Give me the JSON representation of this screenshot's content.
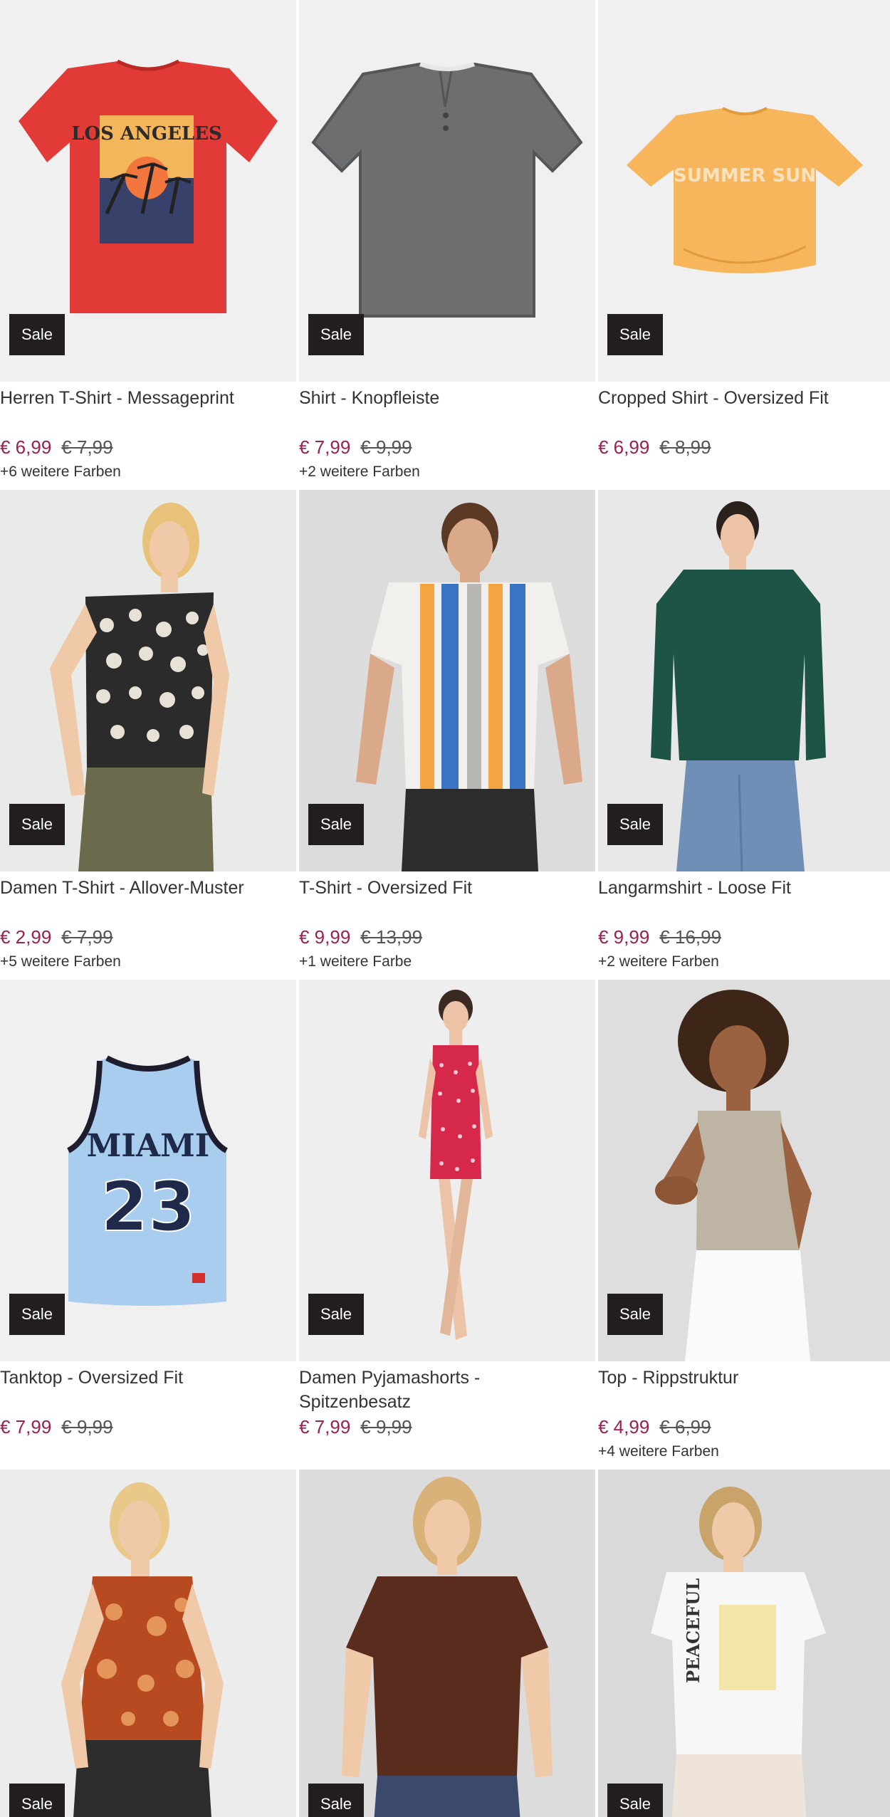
{
  "products": [
    {
      "name": "Herren T-Shirt - Messageprint",
      "badge": "Sale",
      "price": "€ 6,99",
      "old_price": "€ 7,99",
      "colors": "+6 weitere Farben",
      "bg": "#f1f0f0",
      "garment": "#e23a36"
    },
    {
      "name": "Shirt - Knopfleiste",
      "badge": "Sale",
      "price": "€ 7,99",
      "old_price": "€ 9,99",
      "colors": "+2 weitere Farben",
      "bg": "#f1f0f0",
      "garment": "#6d6e70"
    },
    {
      "name": "Cropped Shirt - Oversized Fit",
      "badge": "Sale",
      "price": "€ 6,99",
      "old_price": "€ 8,99",
      "colors": "",
      "bg": "#f1f0f0",
      "garment": "#f7b55c"
    },
    {
      "name": "Damen T-Shirt - Allover-Muster",
      "badge": "Sale",
      "price": "€ 2,99",
      "old_price": "€ 7,99",
      "colors": "+5 weitere Farben",
      "bg": "#e9ebe9",
      "garment": "#2b2b2b"
    },
    {
      "name": "T-Shirt - Oversized Fit",
      "badge": "Sale",
      "price": "€ 9,99",
      "old_price": "€ 13,99",
      "colors": "+1 weitere Farbe",
      "bg": "#dcdcdc",
      "garment": "#f2f0ec"
    },
    {
      "name": "Langarmshirt - Loose Fit",
      "badge": "Sale",
      "price": "€ 9,99",
      "old_price": "€ 16,99",
      "colors": "+2 weitere Farben",
      "bg": "#e8e8e8",
      "garment": "#1e5445"
    },
    {
      "name": "Tanktop - Oversized Fit",
      "badge": "Sale",
      "price": "€ 7,99",
      "old_price": "€ 9,99",
      "colors": "",
      "bg": "#f1f0f0",
      "garment": "#a9cdef"
    },
    {
      "name": "Damen Pyjamashorts - Spitzenbesatz",
      "badge": "Sale",
      "price": "€ 7,99",
      "old_price": "€ 9,99",
      "colors": "",
      "bg": "#eeeeee",
      "garment": "#d6284b"
    },
    {
      "name": "Top - Rippstruktur",
      "badge": "Sale",
      "price": "€ 4,99",
      "old_price": "€ 6,99",
      "colors": "+4 weitere Farben",
      "bg": "#dedede",
      "garment": "#bdb4a3"
    },
    {
      "name": "",
      "badge": "Sale",
      "price": "",
      "old_price": "",
      "colors": "",
      "bg": "#ececec",
      "garment": "#b84a22"
    },
    {
      "name": "",
      "badge": "Sale",
      "price": "",
      "old_price": "",
      "colors": "",
      "bg": "#dcdcdc",
      "garment": "#5a2c1d"
    },
    {
      "name": "",
      "badge": "Sale",
      "price": "",
      "old_price": "",
      "colors": "",
      "bg": "#d9d9d9",
      "garment": "#f7f7f7"
    }
  ],
  "print_text": {
    "shirt1": "LOS ANGELES",
    "shirt3": "SUMMER SUN",
    "tank_city": "MIAMI",
    "tank_number": "23",
    "tee_print": "PEACEFUL"
  }
}
